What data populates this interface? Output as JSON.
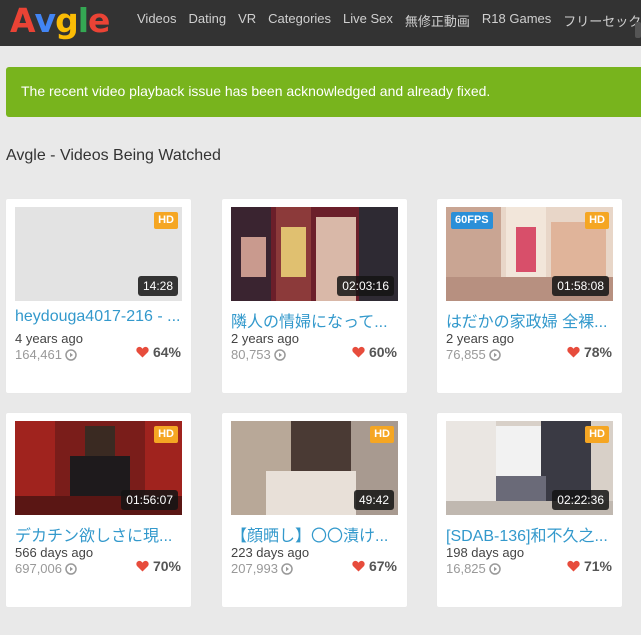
{
  "header": {
    "logo_letters": [
      {
        "char": "A",
        "color": "#ea4335"
      },
      {
        "char": "v",
        "color": "#4285f4"
      },
      {
        "char": "g",
        "color": "#fbbc05"
      },
      {
        "char": "l",
        "color": "#34a853"
      },
      {
        "char": "e",
        "color": "#ea4335"
      }
    ],
    "nav": [
      "Videos",
      "Dating",
      "VR",
      "Categories",
      "Live Sex",
      "無修正動画",
      "R18 Games",
      "フリーセックス"
    ]
  },
  "alert": {
    "text": "The recent video playback issue has been acknowledged and already fixed.",
    "color": "#78b41d"
  },
  "section": {
    "title": "Avgle - Videos Being Watched"
  },
  "colors": {
    "link": "#3399cc",
    "heart": "#e74c3c",
    "hd_badge": "#f5a623",
    "fps_badge": "#2a8fd8"
  },
  "videos": [
    {
      "title": "heydouga4017-216 - ...",
      "age": "4 years ago",
      "views": "164,461",
      "rating": "64%",
      "duration": "14:28",
      "hd": "HD",
      "fps": ""
    },
    {
      "title": "隣人の情婦になって...",
      "age": "2 years ago",
      "views": "80,753",
      "rating": "60%",
      "duration": "02:03:16",
      "hd": "",
      "fps": ""
    },
    {
      "title": "はだかの家政婦 全裸...",
      "age": "2 years ago",
      "views": "76,855",
      "rating": "78%",
      "duration": "01:58:08",
      "hd": "HD",
      "fps": "60FPS"
    },
    {
      "title": "デカチン欲しさに現...",
      "age": "566 days ago",
      "views": "697,006",
      "rating": "70%",
      "duration": "01:56:07",
      "hd": "HD",
      "fps": ""
    },
    {
      "title": "【顔晒し】〇〇漬け...",
      "age": "223 days ago",
      "views": "207,993",
      "rating": "67%",
      "duration": "49:42",
      "hd": "HD",
      "fps": ""
    },
    {
      "title": "[SDAB-136]和不久之...",
      "age": "198 days ago",
      "views": "16,825",
      "rating": "71%",
      "duration": "02:22:36",
      "hd": "HD",
      "fps": ""
    }
  ]
}
